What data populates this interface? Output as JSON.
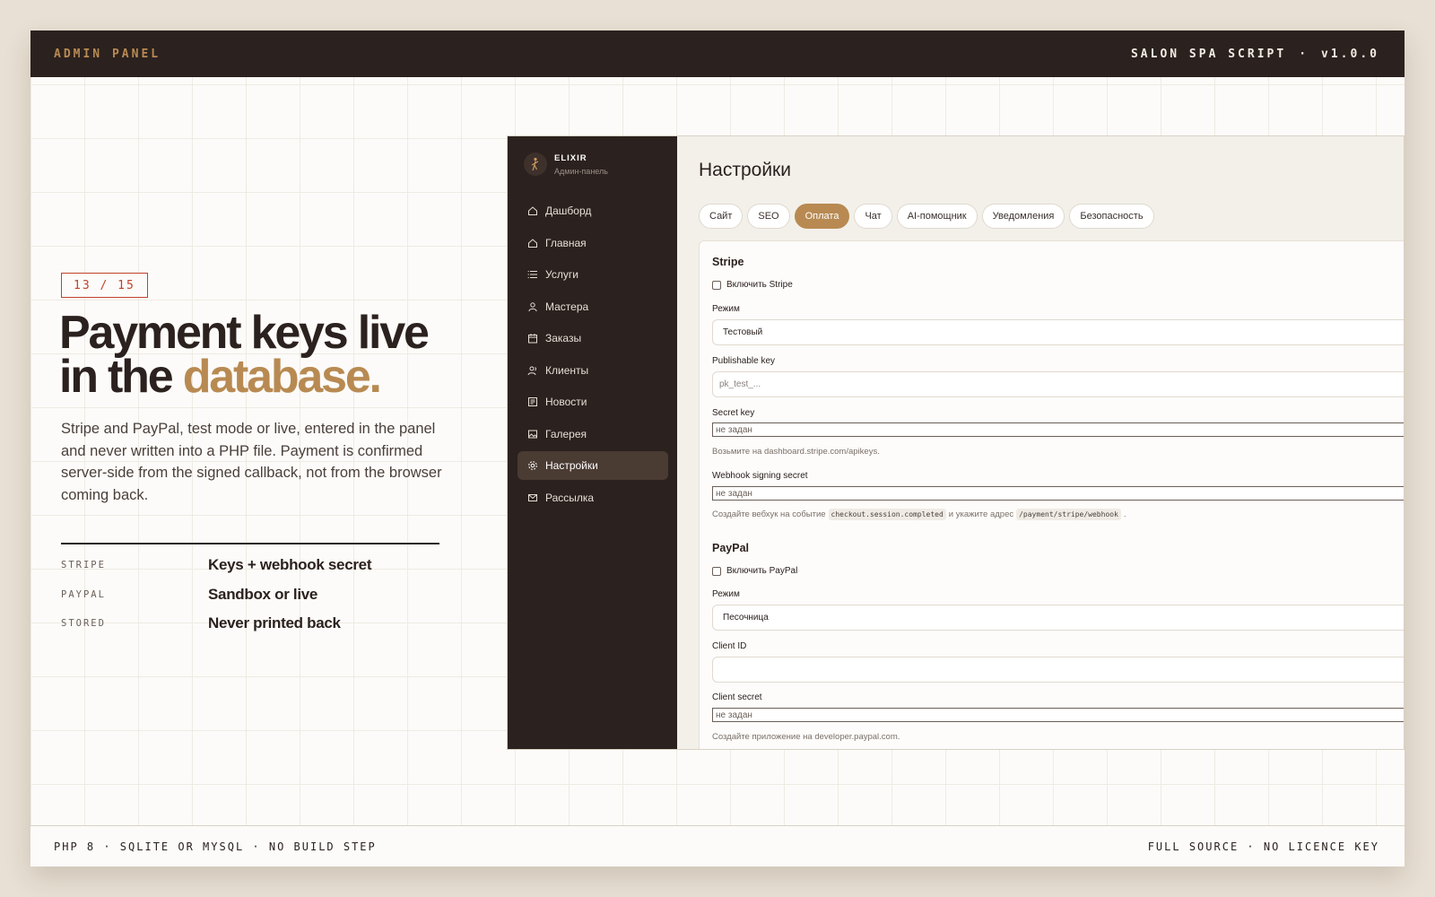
{
  "topbar": {
    "left": "ADMIN PANEL",
    "product": "SALON SPA SCRIPT",
    "sep": "·",
    "version": "v1.0.0"
  },
  "slide": {
    "counter": "13 / 15",
    "headline_line1": "Payment keys live",
    "headline_line2_prefix": "in the ",
    "headline_accent": "database.",
    "lead": "Stripe and PayPal, test mode or live, entered in the panel and never written into a PHP file. Payment is confirmed server-side from the signed callback, not from the browser coming back.",
    "specs": [
      {
        "key": "STRIPE",
        "value": "Keys + webhook secret"
      },
      {
        "key": "PAYPAL",
        "value": "Sandbox or live"
      },
      {
        "key": "STORED",
        "value": "Never printed back"
      }
    ]
  },
  "footer": {
    "left": "PHP 8 · SQLITE OR MYSQL · NO BUILD STEP",
    "right": "FULL SOURCE · NO LICENCE KEY"
  },
  "admin": {
    "brand": {
      "name": "ELIXIR",
      "subtitle": "Админ-панель",
      "logo_icon": "dancer-icon"
    },
    "nav": [
      {
        "label": "Дашборд",
        "icon": "home-icon"
      },
      {
        "label": "Главная",
        "icon": "home-icon"
      },
      {
        "label": "Услуги",
        "icon": "list-icon"
      },
      {
        "label": "Мастера",
        "icon": "user-icon"
      },
      {
        "label": "Заказы",
        "icon": "calendar-icon"
      },
      {
        "label": "Клиенты",
        "icon": "users-icon"
      },
      {
        "label": "Новости",
        "icon": "newspaper-icon"
      },
      {
        "label": "Галерея",
        "icon": "image-icon"
      },
      {
        "label": "Настройки",
        "icon": "gear-icon",
        "active": true
      },
      {
        "label": "Рассылка",
        "icon": "mail-icon"
      }
    ],
    "page_title": "Настройки",
    "tabs": [
      {
        "label": "Сайт"
      },
      {
        "label": "SEO"
      },
      {
        "label": "Оплата",
        "active": true
      },
      {
        "label": "Чат"
      },
      {
        "label": "AI-помощник"
      },
      {
        "label": "Уведомления"
      },
      {
        "label": "Безопасность"
      }
    ],
    "stripe": {
      "title": "Stripe",
      "enable_label": "Включить Stripe",
      "mode_label": "Режим",
      "mode_value": "Тестовый",
      "publishable_label": "Publishable key",
      "publishable_placeholder": "pk_test_...",
      "secret_label": "Secret key",
      "secret_placeholder": "не задан",
      "secret_hint": "Возьмите на dashboard.stripe.com/apikeys.",
      "webhook_label": "Webhook signing secret",
      "webhook_placeholder": "не задан",
      "webhook_hint_1": "Создайте вебхук на событие",
      "webhook_hint_code1": "checkout.session.completed",
      "webhook_hint_2": "и укажите адрес",
      "webhook_hint_code2": "/payment/stripe/webhook",
      "webhook_hint_3": "."
    },
    "paypal": {
      "title": "PayPal",
      "enable_label": "Включить PayPal",
      "mode_label": "Режим",
      "mode_value": "Песочница",
      "client_id_label": "Client ID",
      "client_id_value": "",
      "client_secret_label": "Client secret",
      "client_secret_placeholder": "не задан",
      "client_secret_hint": "Создайте приложение на developer.paypal.com."
    }
  },
  "colors": {
    "accent": "#b88a52",
    "dark": "#2b211e",
    "counter_red": "#c0432b"
  }
}
